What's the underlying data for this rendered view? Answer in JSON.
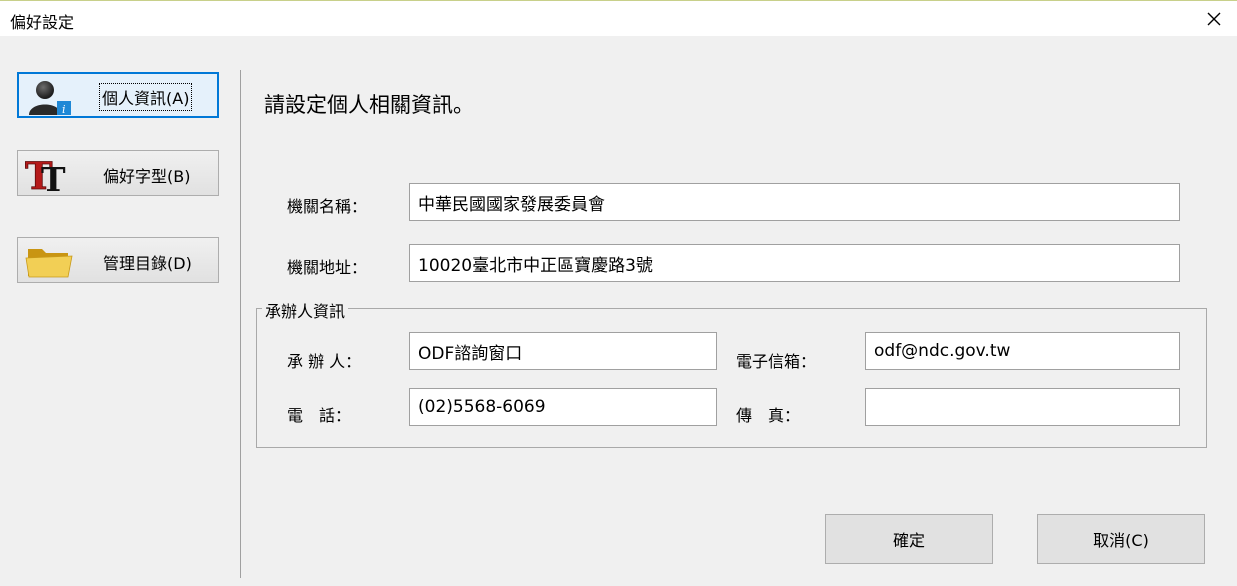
{
  "window": {
    "title": "偏好設定",
    "close_icon": "close-icon"
  },
  "nav": [
    {
      "label": "個人資訊(A)",
      "icon": "user-info-icon",
      "active": true
    },
    {
      "label": "偏好字型(B)",
      "icon": "font-icon",
      "active": false
    },
    {
      "label": "管理目錄(D)",
      "icon": "folder-icon",
      "active": false
    }
  ],
  "main": {
    "heading": "請設定個人相關資訊。",
    "org_name_label": "機關名稱：",
    "org_name_value": "中華民國國家發展委員會",
    "org_address_label": "機關地址：",
    "org_address_value": "10020臺北市中正區寶慶路3號",
    "contact": {
      "legend": "承辦人資訊",
      "handler_label": "承 辦 人：",
      "handler_value": "ODF諮詢窗口",
      "email_label": "電子信箱：",
      "email_value": "odf@ndc.gov.tw",
      "phone_label": "電　話：",
      "phone_value": "(02)5568-6069",
      "fax_label": "傳　真：",
      "fax_value": ""
    },
    "ok_label": "確定",
    "cancel_label": "取消(C)"
  },
  "colors": {
    "accent": "#0078d7",
    "dialog_bg": "#f0f0f0",
    "title_bg": "#ffffff"
  }
}
